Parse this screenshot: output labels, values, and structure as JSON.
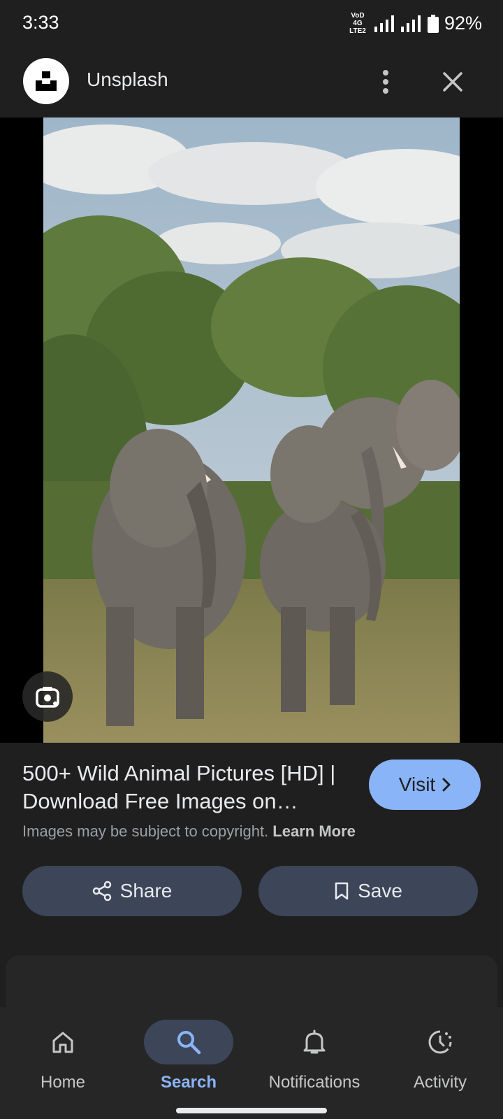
{
  "status_bar": {
    "time": "3:33",
    "network_label_line1": "VoD 4G",
    "network_label_line2": "LTE2",
    "battery": "92%"
  },
  "header": {
    "site_name": "Unsplash",
    "icons": [
      "unsplash-logo-icon",
      "more-vert-icon",
      "close-icon"
    ]
  },
  "image": {
    "subject": "elephants",
    "lens_icon": "google-lens-icon"
  },
  "result": {
    "title": "500+ Wild Animal Pictures [HD] | Download Free Images on…",
    "visit_label": "Visit",
    "copyright_text": "Images may be subject to copyright.",
    "learn_more_label": "Learn More"
  },
  "actions": {
    "share_label": "Share",
    "save_label": "Save"
  },
  "bottom_nav": {
    "items": [
      {
        "label": "Home",
        "icon": "home-icon",
        "active": false
      },
      {
        "label": "Search",
        "icon": "search-icon",
        "active": true
      },
      {
        "label": "Notifications",
        "icon": "bell-icon",
        "active": false
      },
      {
        "label": "Activity",
        "icon": "activity-icon",
        "active": false
      }
    ]
  },
  "colors": {
    "background": "#1f1f1f",
    "accent": "#8ab4f8",
    "button_fill": "#3c4658",
    "muted_text": "#9aa0a6"
  }
}
